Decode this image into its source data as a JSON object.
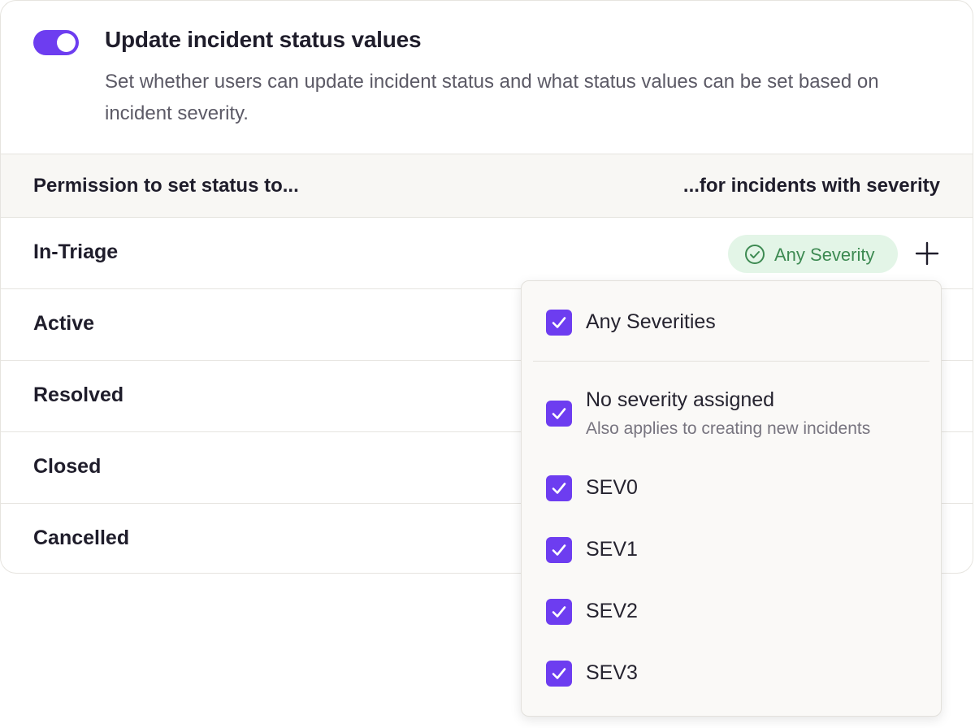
{
  "header": {
    "toggle_on": true,
    "title": "Update incident status values",
    "description": "Set whether users can update incident status and what status values can be set based on incident severity."
  },
  "table": {
    "col_left": "Permission to set status to...",
    "col_right": "...for incidents with severity",
    "rows": [
      {
        "label": "In-Triage",
        "severity": "Any Severity"
      },
      {
        "label": "Active"
      },
      {
        "label": "Resolved"
      },
      {
        "label": "Closed"
      },
      {
        "label": "Cancelled"
      }
    ]
  },
  "dropdown": {
    "options": [
      {
        "label": "Any Severities",
        "checked": true
      },
      {
        "label": "No severity assigned",
        "sublabel": "Also applies to creating new incidents",
        "checked": true
      },
      {
        "label": "SEV0",
        "checked": true
      },
      {
        "label": "SEV1",
        "checked": true
      },
      {
        "label": "SEV2",
        "checked": true
      },
      {
        "label": "SEV3",
        "checked": true
      }
    ]
  },
  "colors": {
    "accent": "#6d3df0",
    "pill_bg": "#e3f5e7",
    "pill_text": "#3d8a52"
  },
  "icons": {
    "toggle": "toggle-switch",
    "pill": "check-circle-icon",
    "add": "plus-icon",
    "checkbox": "checkmark-icon"
  }
}
